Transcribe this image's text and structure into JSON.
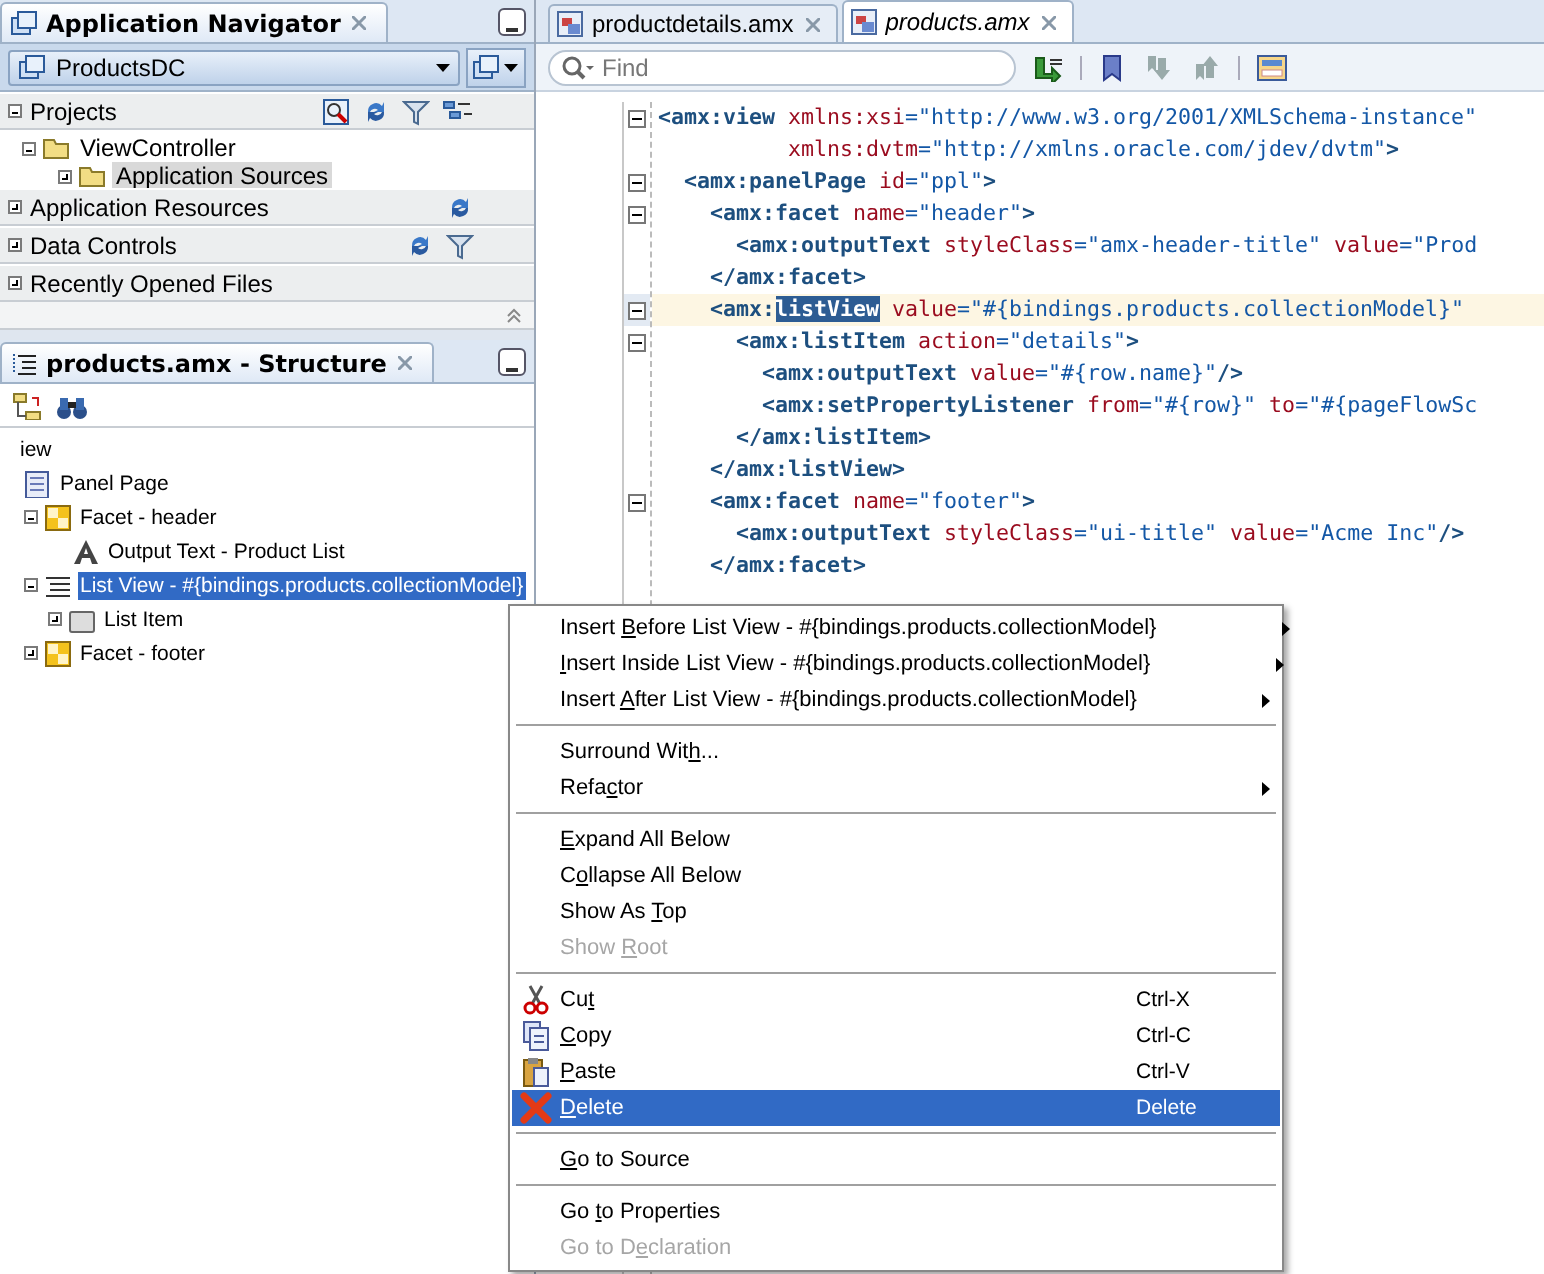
{
  "navigator": {
    "title": "Application Navigator",
    "project": "ProductsDC",
    "sections": [
      {
        "label": "Projects",
        "expanded": true,
        "tree": [
          {
            "label": "ViewController",
            "expanded": true,
            "selected": false,
            "children": [
              {
                "label": "Application Sources",
                "expanded": false,
                "selected": true
              }
            ]
          }
        ]
      },
      {
        "label": "Application Resources",
        "expanded": false
      },
      {
        "label": "Data Controls",
        "expanded": false
      },
      {
        "label": "Recently Opened Files",
        "expanded": false
      }
    ]
  },
  "structure": {
    "title": "products.amx - Structure",
    "nodes": [
      {
        "label": "iew",
        "selected": false,
        "children": [
          {
            "label": "Panel Page",
            "kind": "page",
            "selected": false,
            "children": [
              {
                "label": "Facet - header",
                "kind": "facet",
                "expanded": true,
                "selected": false,
                "children": [
                  {
                    "label": "Output Text - Product List",
                    "kind": "text",
                    "selected": false
                  }
                ]
              },
              {
                "label": "List View - #{bindings.products.collectionModel}",
                "kind": "list",
                "expanded": true,
                "selected": true,
                "children": [
                  {
                    "label": "List Item",
                    "kind": "item",
                    "expanded": false,
                    "selected": false
                  }
                ]
              },
              {
                "label": "Facet - footer",
                "kind": "facet",
                "expanded": false,
                "selected": false
              }
            ]
          }
        ]
      }
    ]
  },
  "editor": {
    "tabs": [
      {
        "label": "productdetails.amx",
        "selected": false
      },
      {
        "label": "products.amx",
        "selected": true
      }
    ],
    "search": {
      "placeholder": "Find"
    },
    "lines": [
      {
        "fold": true,
        "current": false,
        "segments": [
          {
            "kind": "tag",
            "text": "<amx:view"
          },
          {
            "kind": "attr",
            "text": " xmlns:xsi"
          },
          {
            "kind": "value",
            "text": "=\"http://www.w3.org/2001/XMLSchema-instance\""
          }
        ]
      },
      {
        "fold": false,
        "current": false,
        "segments": [
          {
            "kind": "attr",
            "text": "          xmlns:dvtm"
          },
          {
            "kind": "value",
            "text": "=\"http://xmlns.oracle.com/jdev/dvtm\""
          },
          {
            "kind": "tag",
            "text": ">"
          }
        ]
      },
      {
        "fold": true,
        "current": false,
        "segments": [
          {
            "kind": "tag",
            "text": "  <amx:panelPage"
          },
          {
            "kind": "attr",
            "text": " id"
          },
          {
            "kind": "value",
            "text": "=\"ppl\""
          },
          {
            "kind": "tag",
            "text": ">"
          }
        ]
      },
      {
        "fold": true,
        "current": false,
        "segments": [
          {
            "kind": "tag",
            "text": "    <amx:facet"
          },
          {
            "kind": "attr",
            "text": " name"
          },
          {
            "kind": "value",
            "text": "=\"header\""
          },
          {
            "kind": "tag",
            "text": ">"
          }
        ]
      },
      {
        "fold": false,
        "current": false,
        "segments": [
          {
            "kind": "tag",
            "text": "      <amx:outputText"
          },
          {
            "kind": "attr",
            "text": " styleClass"
          },
          {
            "kind": "value",
            "text": "=\"amx-header-title\""
          },
          {
            "kind": "attr",
            "text": " value"
          },
          {
            "kind": "value",
            "text": "=\"Prod"
          }
        ]
      },
      {
        "fold": false,
        "current": false,
        "segments": [
          {
            "kind": "tag",
            "text": "    </amx:facet>"
          }
        ]
      },
      {
        "fold": true,
        "current": true,
        "segments": [
          {
            "kind": "tag",
            "text": "    <amx:"
          },
          {
            "kind": "sel",
            "text": "listView"
          },
          {
            "kind": "attr",
            "text": " value"
          },
          {
            "kind": "value",
            "text": "=\"#{bindings.products.collectionModel}\""
          }
        ]
      },
      {
        "fold": true,
        "current": false,
        "segments": [
          {
            "kind": "tag",
            "text": "      <amx:listItem"
          },
          {
            "kind": "attr",
            "text": " action"
          },
          {
            "kind": "value",
            "text": "=\"details\""
          },
          {
            "kind": "tag",
            "text": ">"
          }
        ]
      },
      {
        "fold": false,
        "current": false,
        "segments": [
          {
            "kind": "tag",
            "text": "        <amx:outputText"
          },
          {
            "kind": "attr",
            "text": " value"
          },
          {
            "kind": "value",
            "text": "=\"#{row.name}\""
          },
          {
            "kind": "tag",
            "text": "/>"
          }
        ]
      },
      {
        "fold": false,
        "current": false,
        "segments": [
          {
            "kind": "tag",
            "text": "        <amx:setPropertyListener"
          },
          {
            "kind": "attr",
            "text": " from"
          },
          {
            "kind": "value",
            "text": "=\"#{row}\""
          },
          {
            "kind": "attr",
            "text": " to"
          },
          {
            "kind": "value",
            "text": "=\"#{pageFlowSc"
          }
        ]
      },
      {
        "fold": false,
        "current": false,
        "segments": [
          {
            "kind": "tag",
            "text": "      </amx:listItem>"
          }
        ]
      },
      {
        "fold": false,
        "current": false,
        "segments": [
          {
            "kind": "tag",
            "text": "    </amx:listView>"
          }
        ]
      },
      {
        "fold": true,
        "current": false,
        "segments": [
          {
            "kind": "tag",
            "text": "    <amx:facet"
          },
          {
            "kind": "attr",
            "text": " name"
          },
          {
            "kind": "value",
            "text": "=\"footer\""
          },
          {
            "kind": "tag",
            "text": ">"
          }
        ]
      },
      {
        "fold": false,
        "current": false,
        "segments": [
          {
            "kind": "tag",
            "text": "      <amx:outputText"
          },
          {
            "kind": "attr",
            "text": " styleClass"
          },
          {
            "kind": "value",
            "text": "=\"ui-title\""
          },
          {
            "kind": "attr",
            "text": " value"
          },
          {
            "kind": "value",
            "text": "=\"Acme Inc\""
          },
          {
            "kind": "tag",
            "text": "/>"
          }
        ]
      },
      {
        "fold": false,
        "current": false,
        "segments": [
          {
            "kind": "tag",
            "text": "    </amx:facet>"
          }
        ]
      }
    ]
  },
  "context_menu": {
    "items": [
      {
        "kind": "item",
        "pre": "Insert ",
        "key": "B",
        "post": "efore List View - #{bindings.products.collectionModel}",
        "submenu": true,
        "disabled": false,
        "selected": false
      },
      {
        "kind": "item",
        "key": "I",
        "post": "nsert Inside List View - #{bindings.products.collectionModel}",
        "submenu": true,
        "disabled": false,
        "selected": false
      },
      {
        "kind": "item",
        "pre": "Insert ",
        "key": "A",
        "post": "fter List View - #{bindings.products.collectionModel}",
        "submenu": true,
        "disabled": false,
        "selected": false
      },
      {
        "kind": "separator"
      },
      {
        "kind": "item",
        "pre": "Surround Wit",
        "key": "h",
        "post": "...",
        "submenu": false,
        "disabled": false,
        "selected": false
      },
      {
        "kind": "item",
        "pre": "Refa",
        "key": "c",
        "post": "tor",
        "submenu": true,
        "disabled": false,
        "selected": false
      },
      {
        "kind": "separator"
      },
      {
        "kind": "item",
        "key": "E",
        "post": "xpand All Below",
        "submenu": false,
        "disabled": false,
        "selected": false
      },
      {
        "kind": "item",
        "pre": "C",
        "key": "o",
        "post": "llapse All Below",
        "submenu": false,
        "disabled": false,
        "selected": false
      },
      {
        "kind": "item",
        "pre": "Show As ",
        "key": "T",
        "post": "op",
        "submenu": false,
        "disabled": false,
        "selected": false
      },
      {
        "kind": "item",
        "pre": "Show ",
        "key": "R",
        "post": "oot",
        "submenu": false,
        "disabled": true,
        "selected": false
      },
      {
        "kind": "separator"
      },
      {
        "kind": "cut",
        "pre": "Cu",
        "key": "t",
        "shortcut": "Ctrl-X",
        "submenu": false,
        "disabled": false,
        "selected": false
      },
      {
        "kind": "copy",
        "key": "C",
        "post": "opy",
        "shortcut": "Ctrl-C",
        "submenu": false,
        "disabled": false,
        "selected": false
      },
      {
        "kind": "paste",
        "key": "P",
        "post": "aste",
        "shortcut": "Ctrl-V",
        "submenu": false,
        "disabled": false,
        "selected": false
      },
      {
        "kind": "delete",
        "key": "D",
        "post": "elete",
        "shortcut": "Delete",
        "submenu": false,
        "disabled": false,
        "selected": true
      },
      {
        "kind": "separator"
      },
      {
        "kind": "item",
        "key": "G",
        "post": "o to Source",
        "submenu": false,
        "disabled": false,
        "selected": false
      },
      {
        "kind": "separator"
      },
      {
        "kind": "item",
        "pre": "Go ",
        "key": "t",
        "post": "o Properties",
        "submenu": false,
        "disabled": false,
        "selected": false
      },
      {
        "kind": "item",
        "pre": "Go to D",
        "key": "e",
        "post": "claration",
        "submenu": false,
        "disabled": true,
        "selected": false
      }
    ]
  }
}
